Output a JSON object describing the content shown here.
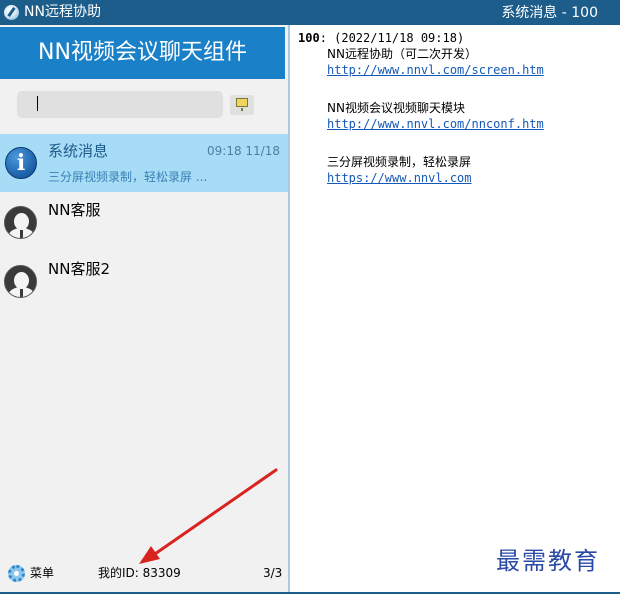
{
  "window": {
    "app_title": "NN远程协助",
    "chat_title": "系统消息 - 100"
  },
  "left_pane": {
    "component_title": "NN视频会议聊天组件",
    "search": {
      "value": ""
    },
    "conversations": [
      {
        "name": "系统消息",
        "time": "09:18 11/18",
        "preview": "三分屏视频录制，轻松录屏 ...",
        "icon": "info-icon",
        "selected": true
      },
      {
        "name": "NN客服",
        "icon": "user-avatar-icon"
      },
      {
        "name": "NN客服2",
        "icon": "user-avatar-icon"
      }
    ]
  },
  "footer": {
    "menu_label": "菜单",
    "my_id": "我的ID: 83309",
    "page_count": "3/3"
  },
  "messages": {
    "sender_id": "100",
    "timestamp": ": (2022/11/18 09:18)",
    "blocks": [
      {
        "text": "NN远程协助（可二次开发）",
        "link": "http://www.nnvl.com/screen.htm"
      },
      {
        "text": "NN视频会议视频聊天模块",
        "link": "http://www.nnvl.com/nnconf.htm"
      },
      {
        "text": "三分屏视频录制，轻松录屏",
        "link": "https://www.nnvl.com"
      }
    ]
  },
  "watermark": "最需教育",
  "colors": {
    "titlebar": "#1c5d8b",
    "component_header": "#1a80c7",
    "selected_item": "#a7dcf6",
    "link": "#1559b8",
    "annotation_arrow": "#d9231f"
  }
}
